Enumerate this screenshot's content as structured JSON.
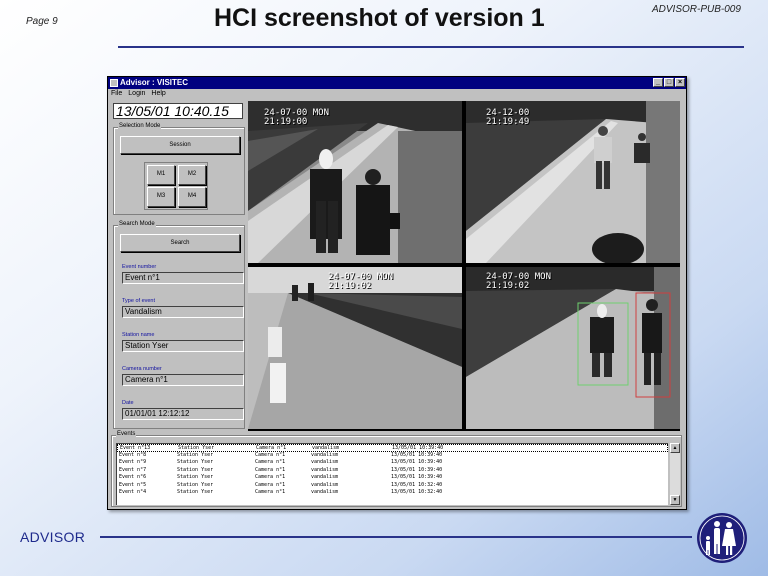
{
  "slide": {
    "page_label": "Page 9",
    "title": "HCI screenshot of version 1",
    "doc_id": "ADVISOR-PUB-009",
    "footer_brand": "ADVISOR"
  },
  "app": {
    "window_title": "Advisor : VISITEC",
    "menu": [
      "File",
      "Login",
      "Help"
    ],
    "clock": "13/05/01 10:40.15",
    "selection_mode": {
      "label": "Selection Mode",
      "session_button": "Session",
      "monitors": [
        "M1",
        "M2",
        "M3",
        "M4"
      ]
    },
    "search_mode": {
      "label": "Search Mode",
      "search_button": "Search",
      "fields": [
        {
          "label": "Event number",
          "value": "Event n°1"
        },
        {
          "label": "Type of event",
          "value": "Vandalism"
        },
        {
          "label": "Station name",
          "value": "Station Yser"
        },
        {
          "label": "Camera number",
          "value": "Camera n°1"
        },
        {
          "label": "Date",
          "value": "01/01/01 12:12:12"
        }
      ]
    },
    "cameras": [
      {
        "timestamp": "24-07-00 MON\n21:19:00"
      },
      {
        "timestamp": "24-12-00\n21:19:49"
      },
      {
        "timestamp": "24-07-00 MON\n21:19:02"
      },
      {
        "timestamp": "24-07-00 MON\n21:19:02"
      }
    ],
    "events": {
      "label": "Events",
      "rows": [
        [
          "Event n°13",
          "Station Yser",
          "Camera n°1",
          "vandalism",
          "13/05/01 10:39:40"
        ],
        [
          "Event n°8",
          "Station Yser",
          "Camera n°1",
          "vandalism",
          "13/05/01 10:39:40"
        ],
        [
          "Event n°9",
          "Station Yser",
          "Camera n°1",
          "vandalism",
          "13/05/01 10:39:40"
        ],
        [
          "Event n°7",
          "Station Yser",
          "Camera n°1",
          "vandalism",
          "13/05/01 10:39:40"
        ],
        [
          "Event n°6",
          "Station Yser",
          "Camera n°1",
          "vandalism",
          "13/05/01 10:39:40"
        ],
        [
          "Event n°5",
          "Station Yser",
          "Camera n°1",
          "vandalism",
          "13/05/01 10:32:40"
        ],
        [
          "Event n°4",
          "Station Yser",
          "Camera n°1",
          "vandalism",
          "13/05/01 10:32:40"
        ]
      ]
    }
  },
  "colors": {
    "titlebar": "#000080",
    "rule": "#29338a",
    "footer_text": "#1e2a8c",
    "logo": "#1f1f7a"
  },
  "icons": [
    "advisor-logo-icon",
    "app-icon",
    "minimize-icon",
    "maximize-icon",
    "close-icon",
    "scroll-up-icon",
    "scroll-down-icon"
  ]
}
